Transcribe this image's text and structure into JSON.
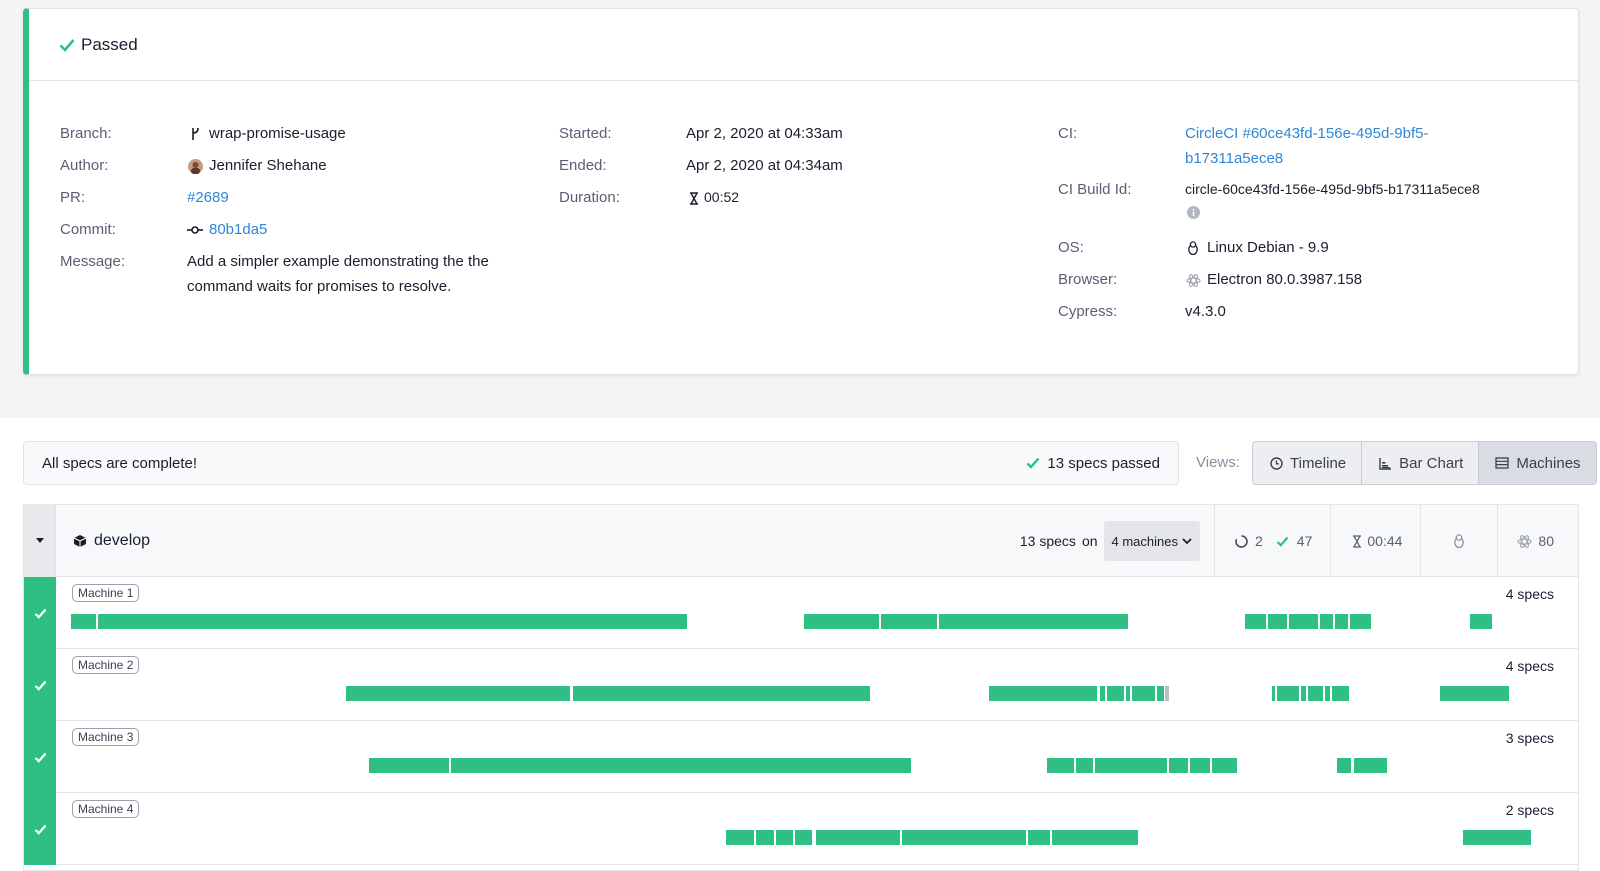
{
  "status": {
    "label": "Passed"
  },
  "meta_left": [
    {
      "label": "Branch:",
      "value": "wrap-promise-usage",
      "icon": "branch-icon"
    },
    {
      "label": "Author:",
      "value": "Jennifer Shehane",
      "icon": "avatar"
    },
    {
      "label": "PR:",
      "value": "#2689",
      "link": true
    },
    {
      "label": "Commit:",
      "value": "80b1da5",
      "icon": "commit-icon",
      "link": true
    },
    {
      "label": "Message:",
      "value": "Add a simpler example demonstrating the the",
      "value2": "command waits for promises to resolve."
    }
  ],
  "meta_mid": [
    {
      "label": "Started:",
      "value": "Apr 2, 2020 at 04:33am"
    },
    {
      "label": "Ended:",
      "value": "Apr 2, 2020 at 04:34am"
    },
    {
      "label": "Duration:",
      "value": "00:52",
      "icon": "hourglass-icon"
    }
  ],
  "meta_right": [
    {
      "label": "CI:",
      "value": "CircleCI #60ce43fd-156e-495d-9bf5-",
      "value2": "b17311a5ece8",
      "link": true
    },
    {
      "label": "CI Build Id:",
      "value": "circle-60ce43fd-156e-495d-9bf5-b17311a5ece8",
      "icon_after": "info-icon"
    },
    {
      "label": "OS:",
      "value": "Linux Debian - 9.9",
      "icon": "linux-icon"
    },
    {
      "label": "Browser:",
      "value": "Electron 80.0.3987.158",
      "icon": "electron-icon"
    },
    {
      "label": "Cypress:",
      "value": "v4.3.0"
    }
  ],
  "status_bar": {
    "message": "All specs are complete!",
    "passed": "13 specs passed"
  },
  "views": {
    "label": "Views:",
    "buttons": [
      {
        "label": "Timeline",
        "icon": "clock-icon"
      },
      {
        "label": "Bar Chart",
        "icon": "bar-chart-icon"
      },
      {
        "label": "Machines",
        "icon": "machines-icon",
        "active": true
      }
    ]
  },
  "group": {
    "name": "develop",
    "spec_count": "13 specs",
    "on": "on",
    "machines_select": "4 machines",
    "stats": {
      "pending": "2",
      "passed": "47",
      "duration": "00:44",
      "browser_version": "80"
    }
  },
  "machines": [
    {
      "name": "Machine 1",
      "specs": "4 specs"
    },
    {
      "name": "Machine 2",
      "specs": "4 specs"
    },
    {
      "name": "Machine 3",
      "specs": "3 specs"
    },
    {
      "name": "Machine 4",
      "specs": "2 specs"
    }
  ],
  "colors": {
    "success": "#2fbf84",
    "link": "#2f86d7"
  }
}
